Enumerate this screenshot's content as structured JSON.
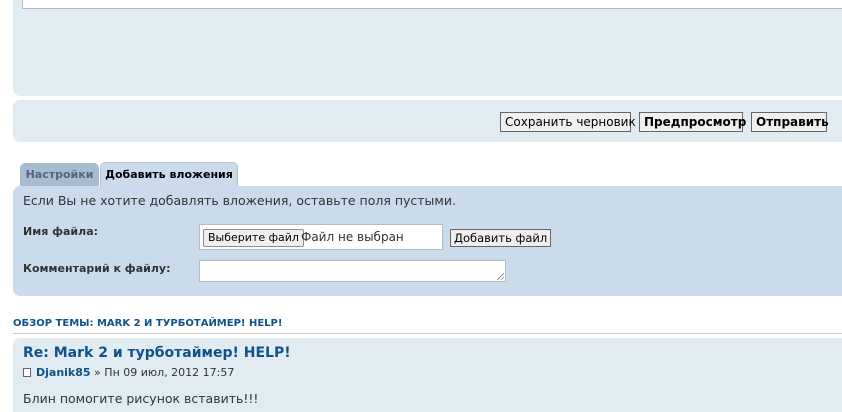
{
  "actions": {
    "save_draft": "Сохранить черновик",
    "preview": "Предпросмотр",
    "submit": "Отправить"
  },
  "tabs": [
    {
      "label": "Настройки"
    },
    {
      "label": "Добавить вложения"
    }
  ],
  "attachments": {
    "note": "Если Вы не хотите добавлять вложения, оставьте поля пустыми.",
    "filename_label": "Имя файла:",
    "choose_file": "Выберите файл",
    "file_status": "Файл не выбран",
    "add_file": "Добавить файл",
    "comment_label": "Комментарий к файлу:",
    "comment_value": ""
  },
  "topic_review": {
    "heading": "Обзор темы: Mark 2 и турботаймер! HELP!"
  },
  "post": {
    "title": "Re: Mark 2 и турботаймер! HELP!",
    "author": "Djanik85",
    "separator": " » ",
    "date": "Пн 09 июл, 2012 17:57",
    "body": "Блин помогите рисунок вставить!!!"
  }
}
